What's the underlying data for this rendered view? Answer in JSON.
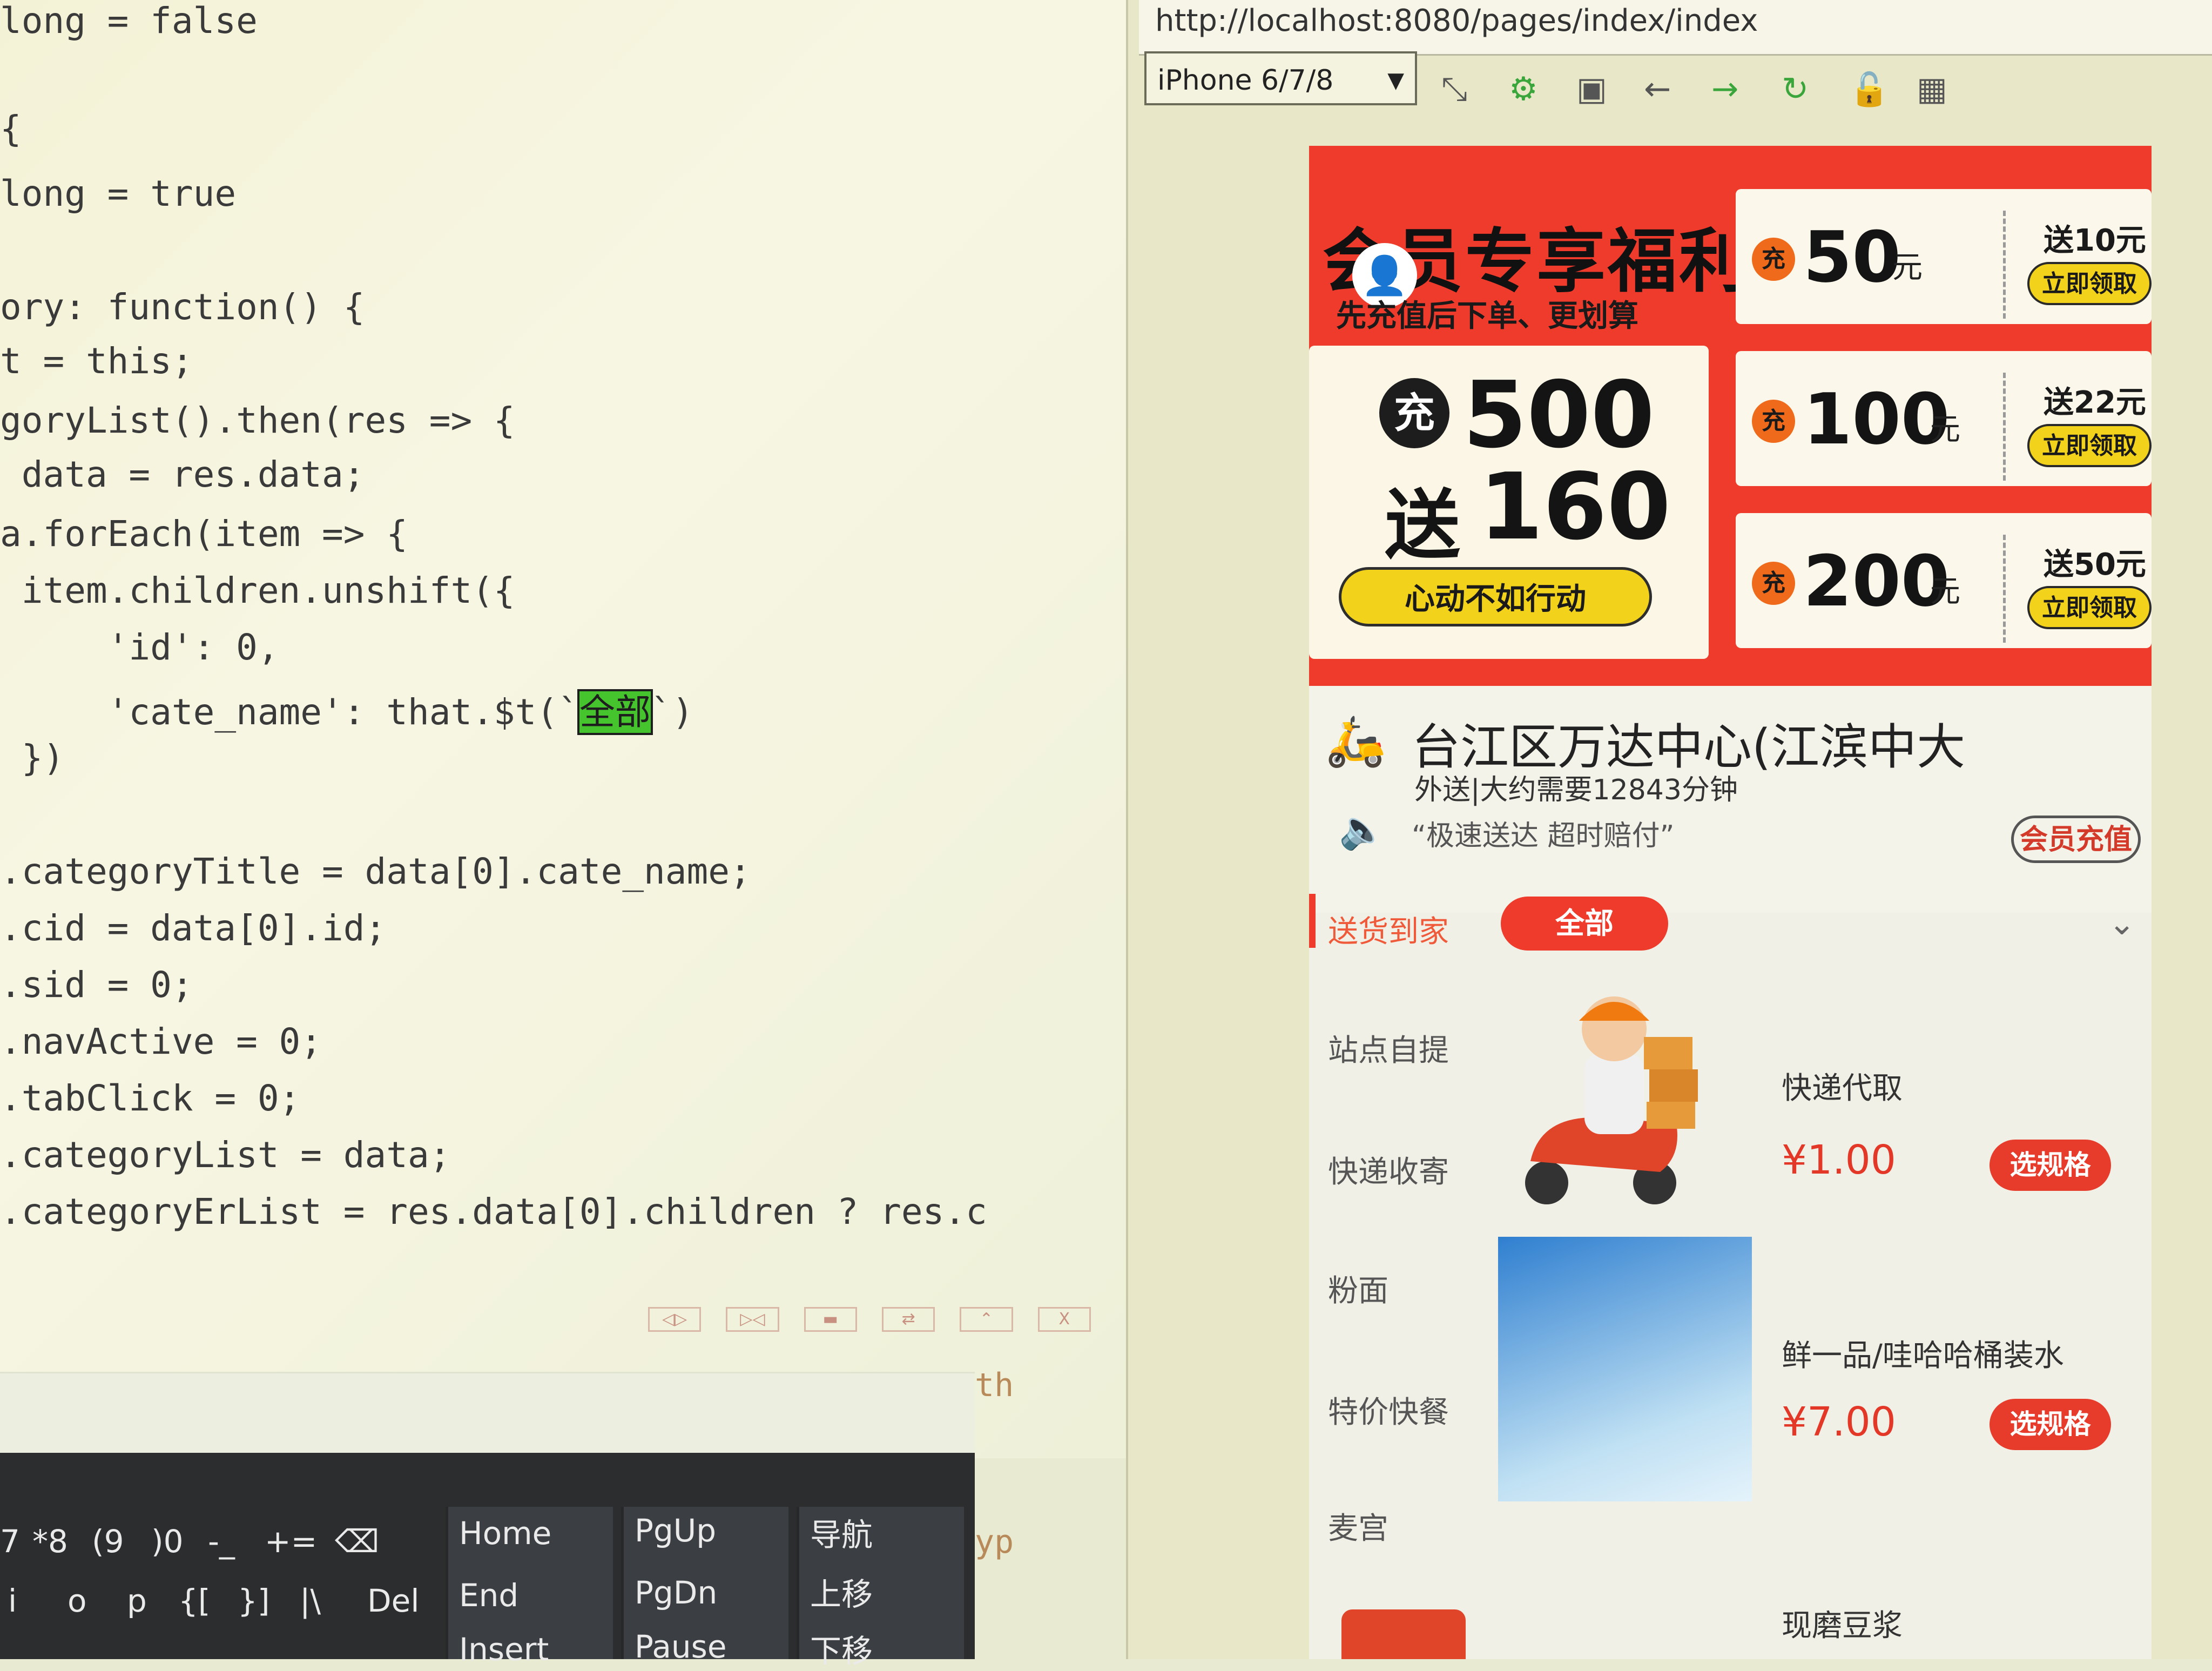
{
  "editor": {
    "lines": [
      "long = false",
      "{",
      "long = true",
      "ory: function() {",
      "t = this;",
      "goryList().then(res => {",
      " data = res.data;",
      "a.forEach(item => {",
      " item.children.unshift({",
      "     'id': 0,",
      "     'cate_name': that.$t(`全部`)",
      " })",
      ".categoryTitle = data[0].cate_name;",
      ".cid = data[0].id;",
      ".sid = 0;",
      ".navActive = 0;",
      ".tabClick = 0;",
      ".categoryList = data;",
      ".categoryErList = res.data[0].children ? res.c"
    ],
    "highlighted_text": "全部",
    "panel_text": "th",
    "panel_text2": "yp"
  },
  "keyboard": {
    "row1": [
      "7",
      "*8",
      "(9",
      ")0",
      "-_",
      "+=",
      "⌫"
    ],
    "row2": [
      "i",
      "o",
      "p",
      "{[",
      "}]",
      "|\\",
      "Del"
    ],
    "nav_keys": [
      "Home",
      "PgUp",
      "导航",
      "End",
      "PgDn",
      "上移",
      "Insert",
      "Pause",
      "下移"
    ]
  },
  "browser": {
    "url": "http://localhost:8080/pages/index/index",
    "device": "iPhone 6/7/8",
    "tool_icons": [
      "rotate-icon",
      "settings-icon",
      "terminal-icon",
      "back-icon",
      "forward-icon",
      "refresh-icon",
      "lock-icon",
      "qr-icon"
    ]
  },
  "promo": {
    "title": "会员专享福利",
    "subtitle": "先充值后下单、更划算",
    "main_charge_mark": "充",
    "main_amount": "500",
    "main_gift_label": "送",
    "main_gift_amount": "160",
    "main_button": "心动不如行动",
    "coupons": [
      {
        "mark": "充",
        "amount": "50",
        "unit": "元",
        "gift": "送10元",
        "button": "立即领取"
      },
      {
        "mark": "充",
        "amount": "100",
        "unit": "元",
        "gift": "送22元",
        "button": "立即领取"
      },
      {
        "mark": "充",
        "amount": "200",
        "unit": "元",
        "gift": "送50元",
        "button": "立即领取"
      }
    ]
  },
  "store": {
    "name": "台江区万达中心(江滨中大",
    "delivery": "外送|大约需要12843分钟",
    "notice": "“极速送达 超时赔付”",
    "member_badge": "会员充值"
  },
  "categories": {
    "items": [
      "送货到家",
      "站点自提",
      "快递收寄",
      "粉面",
      "特价快餐",
      "麦宫"
    ],
    "active_subcategory": "全部"
  },
  "products": [
    {
      "name": "快递代取",
      "price": "¥1.00",
      "button": "选规格"
    },
    {
      "name": "鲜一品/哇哈哈桶装水",
      "price": "¥7.00",
      "button": "选规格"
    },
    {
      "name": "现磨豆浆"
    }
  ],
  "colors": {
    "brand_red": "#ef3b2b",
    "coupon_yellow": "#f2d21a",
    "price_red": "#e33828"
  }
}
